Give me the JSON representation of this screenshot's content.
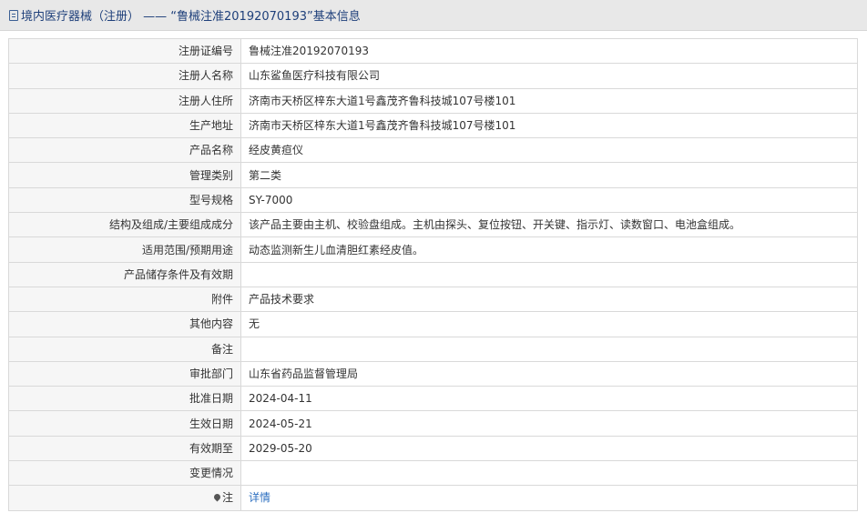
{
  "header": {
    "category": "境内医疗器械（注册）",
    "separator": " —— ",
    "record_title": "“鲁械注准20192070193”基本信息"
  },
  "rows": [
    {
      "label": "注册证编号",
      "value": "鲁械注准20192070193"
    },
    {
      "label": "注册人名称",
      "value": "山东鲨鱼医疗科技有限公司"
    },
    {
      "label": "注册人住所",
      "value": "济南市天桥区梓东大道1号鑫茂齐鲁科技城107号楼101"
    },
    {
      "label": "生产地址",
      "value": "济南市天桥区梓东大道1号鑫茂齐鲁科技城107号楼101"
    },
    {
      "label": "产品名称",
      "value": "经皮黄疸仪"
    },
    {
      "label": "管理类别",
      "value": "第二类"
    },
    {
      "label": "型号规格",
      "value": "SY-7000"
    },
    {
      "label": "结构及组成/主要组成成分",
      "value": "该产品主要由主机、校验盘组成。主机由探头、复位按钮、开关键、指示灯、读数窗口、电池盒组成。"
    },
    {
      "label": "适用范围/预期用途",
      "value": "动态监测新生儿血清胆红素经皮值。"
    },
    {
      "label": "产品储存条件及有效期",
      "value": ""
    },
    {
      "label": "附件",
      "value": "产品技术要求"
    },
    {
      "label": "其他内容",
      "value": "无"
    },
    {
      "label": "备注",
      "value": ""
    },
    {
      "label": "审批部门",
      "value": "山东省药品监督管理局"
    },
    {
      "label": "批准日期",
      "value": "2024-04-11"
    },
    {
      "label": "生效日期",
      "value": "2024-05-21"
    },
    {
      "label": "有效期至",
      "value": "2029-05-20"
    },
    {
      "label": "变更情况",
      "value": ""
    }
  ],
  "note_row": {
    "label": "注",
    "icon": "pin-icon",
    "link_text": "详情"
  }
}
